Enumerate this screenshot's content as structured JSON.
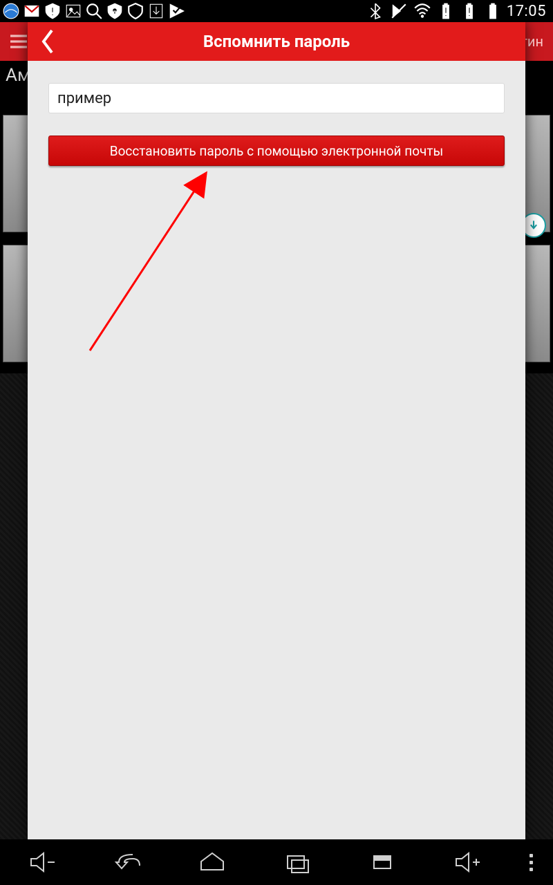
{
  "statusbar": {
    "time": "17:05"
  },
  "app": {
    "login_label": "гин",
    "page_title": "Ам"
  },
  "modal": {
    "title": "Вспомнить пароль",
    "input_value": "пример",
    "recover_label": "Восстановить пароль с помощью электронной почты"
  }
}
